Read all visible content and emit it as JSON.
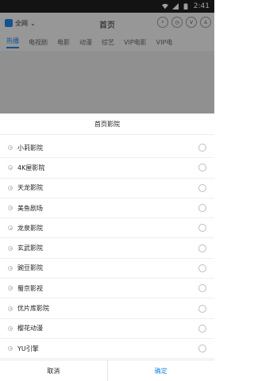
{
  "status": {
    "time": "2:41"
  },
  "header": {
    "scope_label": "全网",
    "title": "首页"
  },
  "tabs": [
    "热播",
    "电视剧",
    "电影",
    "动漫",
    "综艺",
    "VIP电影",
    "VIP电"
  ],
  "dialog": {
    "title": "首页影院",
    "items": [
      "小莉影院",
      "4K屋影院",
      "天龙影院",
      "美鱼剧场",
      "龙泉影院",
      "玄武影院",
      "豌豆影院",
      "蜀京影视",
      "优片库影院",
      "樱花动漫",
      "YU引擎"
    ],
    "cancel_label": "取消",
    "ok_label": "确定"
  },
  "colors": {
    "accent": "#1e88e5"
  }
}
